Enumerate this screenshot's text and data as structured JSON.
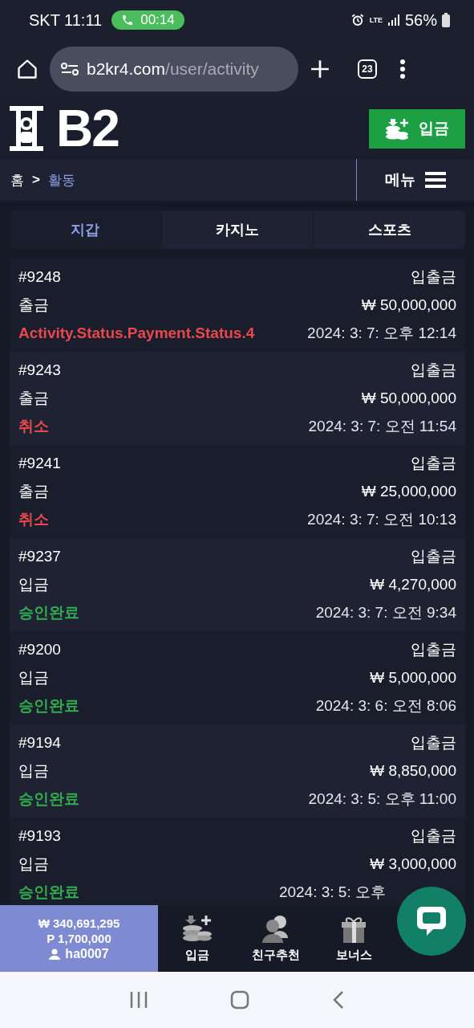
{
  "status_bar": {
    "carrier_time": "SKT 11:11",
    "call_timer": "00:14",
    "network": "LTE",
    "battery": "56%"
  },
  "browser": {
    "url_host": "b2kr4.com",
    "url_path": "/user/activity",
    "tab_count": "23"
  },
  "header": {
    "logo": "B2",
    "deposit_button": "입금"
  },
  "breadcrumb": {
    "home": "홈",
    "separator": ">",
    "current": "활동",
    "menu": "메뉴"
  },
  "tabs": [
    {
      "label": "지갑",
      "selected": true
    },
    {
      "label": "카지노",
      "selected": false
    },
    {
      "label": "스포츠",
      "selected": false
    }
  ],
  "activities": [
    {
      "id": "#9248",
      "category": "입출금",
      "type": "출금",
      "amount": "₩ 50,000,000",
      "status": "Activity.Status.Payment.Status.4",
      "color": "#e8474c",
      "date": "2024: 3: 7: 오후 12:14"
    },
    {
      "id": "#9243",
      "category": "입출금",
      "type": "출금",
      "amount": "₩ 50,000,000",
      "status": "취소",
      "color": "#e8474c",
      "date": "2024: 3: 7: 오전 11:54"
    },
    {
      "id": "#9241",
      "category": "입출금",
      "type": "출금",
      "amount": "₩ 25,000,000",
      "status": "취소",
      "color": "#e8474c",
      "date": "2024: 3: 7: 오전 10:13"
    },
    {
      "id": "#9237",
      "category": "입출금",
      "type": "입금",
      "amount": "₩ 4,270,000",
      "status": "승인완료",
      "color": "#2fae4e",
      "date": "2024: 3: 7: 오전 9:34"
    },
    {
      "id": "#9200",
      "category": "입출금",
      "type": "입금",
      "amount": "₩ 5,000,000",
      "status": "승인완료",
      "color": "#2fae4e",
      "date": "2024: 3: 6: 오전 8:06"
    },
    {
      "id": "#9194",
      "category": "입출금",
      "type": "입금",
      "amount": "₩ 8,850,000",
      "status": "승인완료",
      "color": "#2fae4e",
      "date": "2024: 3: 5: 오후 11:00"
    },
    {
      "id": "#9193",
      "category": "입출금",
      "type": "입금",
      "amount": "₩ 3,000,000",
      "status": "승인완료",
      "color": "#2fae4e",
      "date": "2024: 3: 5: 오후"
    }
  ],
  "account": {
    "balance": "₩ 340,691,295",
    "points": "P 1,700,000",
    "username": "ha0007"
  },
  "bottom_nav": [
    {
      "label": "입금",
      "kind": "coins"
    },
    {
      "label": "친구추천",
      "kind": "friends"
    },
    {
      "label": "보너스",
      "kind": "gift"
    }
  ]
}
